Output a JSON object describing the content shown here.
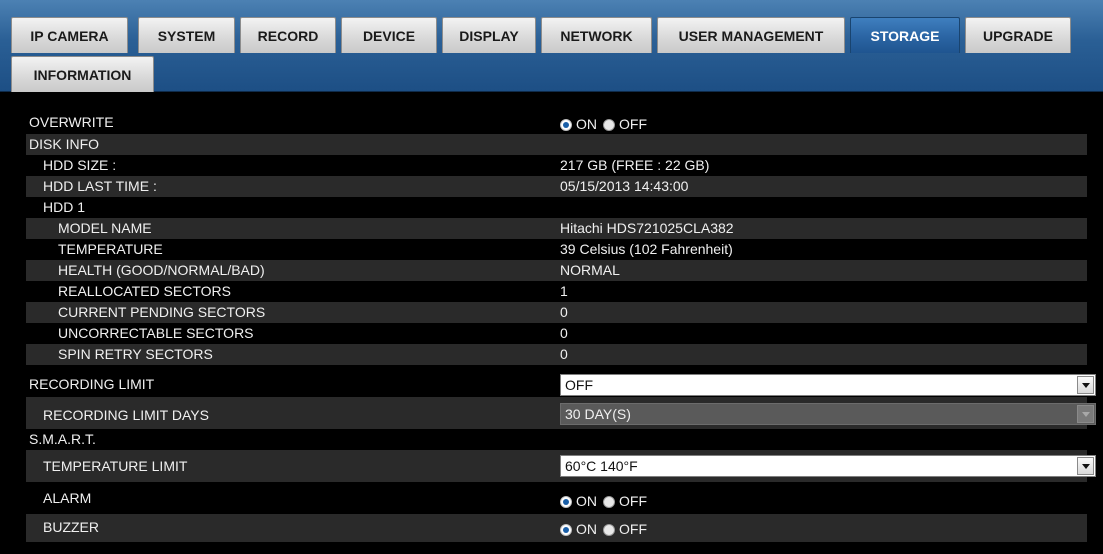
{
  "tabs": [
    {
      "label": "IP CAMERA"
    },
    {
      "label": "SYSTEM"
    },
    {
      "label": "RECORD"
    },
    {
      "label": "DEVICE"
    },
    {
      "label": "DISPLAY"
    },
    {
      "label": "NETWORK"
    },
    {
      "label": "USER MANAGEMENT"
    },
    {
      "label": "STORAGE",
      "active": true
    },
    {
      "label": "UPGRADE"
    },
    {
      "label": "INFORMATION"
    }
  ],
  "radio_labels": {
    "on": "ON",
    "off": "OFF"
  },
  "overwrite": {
    "label": "OVERWRITE",
    "value": "ON"
  },
  "disk_info": {
    "label": "DISK INFO",
    "hdd_size": {
      "label": "HDD SIZE :",
      "value": "217 GB (FREE : 22 GB)"
    },
    "hdd_last_time": {
      "label": "HDD LAST TIME :",
      "value": "05/15/2013 14:43:00"
    },
    "hdd1": {
      "label": "HDD 1",
      "model_name": {
        "label": "MODEL NAME",
        "value": "Hitachi HDS721025CLA382"
      },
      "temperature": {
        "label": "TEMPERATURE",
        "value": "39 Celsius (102 Fahrenheit)"
      },
      "health": {
        "label": "HEALTH (GOOD/NORMAL/BAD)",
        "value": "NORMAL"
      },
      "reallocated": {
        "label": "REALLOCATED SECTORS",
        "value": "1"
      },
      "pending": {
        "label": "CURRENT PENDING SECTORS",
        "value": "0"
      },
      "uncorrectable": {
        "label": "UNCORRECTABLE SECTORS",
        "value": "0"
      },
      "spin_retry": {
        "label": "SPIN RETRY SECTORS",
        "value": "0"
      }
    }
  },
  "recording_limit": {
    "label": "RECORDING LIMIT",
    "value": "OFF"
  },
  "recording_limit_days": {
    "label": "RECORDING LIMIT DAYS",
    "value": "30 DAY(S)"
  },
  "smart": {
    "label": "S.M.A.R.T.",
    "temperature_limit": {
      "label": "TEMPERATURE LIMIT",
      "value": "60°C 140°F"
    },
    "alarm": {
      "label": "ALARM",
      "value": "ON"
    },
    "buzzer": {
      "label": "BUZZER",
      "value": "ON"
    }
  },
  "colors": {
    "accent": "#2a64a3",
    "tab_bar": "#1d4f85",
    "row_alt": "#2a2a2a",
    "background": "#000000"
  }
}
